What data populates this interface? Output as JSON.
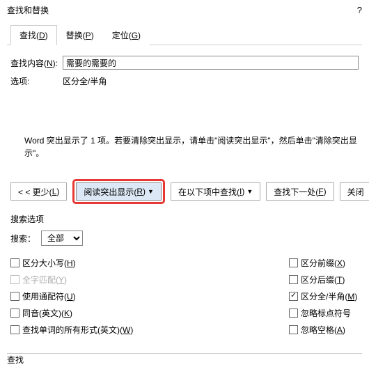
{
  "title": "查找和替换",
  "help": "?",
  "tabs": {
    "find": {
      "label": "查找(",
      "key": "D",
      "suffix": ")"
    },
    "replace": {
      "label": "替换(",
      "key": "P",
      "suffix": ")"
    },
    "goto": {
      "label": "定位(",
      "key": "G",
      "suffix": ")"
    }
  },
  "form": {
    "findLabel": "查找内容(",
    "findKey": "N",
    "findSuffix": "):",
    "findValue": "需要的需要的",
    "optionsLabel": "选项:",
    "optionsValue": "区分全/半角"
  },
  "message": "Word 突出显示了 1 项。若要清除突出显示，请单击\"阅读突出显示\"，然后单击\"清除突出显示\"。",
  "buttons": {
    "less": {
      "prefix": "< <  更少(",
      "key": "L",
      "suffix": ")"
    },
    "highlight": {
      "prefix": "阅读突出显示(",
      "key": "R",
      "suffix": ")"
    },
    "findIn": {
      "prefix": "在以下项中查找(",
      "key": "I",
      "suffix": ")"
    },
    "findNext": {
      "prefix": "查找下一处(",
      "key": "F",
      "suffix": ")"
    },
    "close": "关闭"
  },
  "searchOptions": {
    "heading": "搜索选项",
    "searchLabel": "搜索：",
    "searchValue": "全部"
  },
  "checks": {
    "left": {
      "case": {
        "prefix": "区分大小写(",
        "key": "H",
        "suffix": ")"
      },
      "whole": {
        "prefix": "全字匹配(",
        "key": "Y",
        "suffix": ")"
      },
      "wildcard": {
        "prefix": "使用通配符(",
        "key": "U",
        "suffix": ")"
      },
      "homophone": {
        "prefix": "同音(英文)(",
        "key": "K",
        "suffix": ")"
      },
      "allforms": {
        "prefix": "查找单词的所有形式(英文)(",
        "key": "W",
        "suffix": ")"
      }
    },
    "right": {
      "prefix": {
        "prefix": "区分前缀(",
        "key": "X",
        "suffix": ")"
      },
      "suffix": {
        "prefix": "区分后缀(",
        "key": "T",
        "suffix": ")"
      },
      "halfwidth": {
        "prefix": "区分全/半角(",
        "key": "M",
        "suffix": ")"
      },
      "punct": {
        "prefix": "忽略标点符号",
        "key": "",
        "suffix": ""
      },
      "space": {
        "prefix": "忽略空格(",
        "key": "A",
        "suffix": ")"
      }
    }
  },
  "bottomHint": "查找"
}
